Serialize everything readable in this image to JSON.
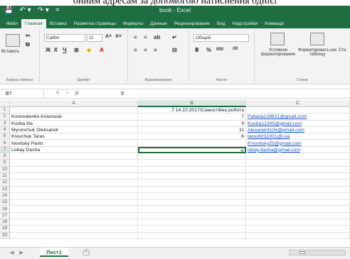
{
  "doc_caption": "ониим адресам за допомогою натиснення однієї",
  "window": {
    "title": "book - Excel"
  },
  "quick_access": [
    "💾",
    "↶ ▾",
    "↷ ▾",
    "="
  ],
  "tabs": [
    "Файл",
    "Главная",
    "Вставка",
    "Разметка страницы",
    "Формулы",
    "Данные",
    "Рецензирование",
    "Вид",
    "Надстройки",
    "Команда"
  ],
  "active_tab": "Главная",
  "ribbon": {
    "clipboard": {
      "label": "Буфер обмена",
      "paste": "Вставить"
    },
    "font": {
      "label": "Шрифт",
      "name": "Calibri",
      "size": "11",
      "grow": "A˄",
      "shrink": "A˅",
      "bold": "Ж",
      "italic": "К",
      "underline": "Ч"
    },
    "alignment": {
      "label": "Выравнивание"
    },
    "number": {
      "label": "Число",
      "format": "Общий",
      "percent": "%",
      "thousands": "000"
    },
    "styles": {
      "label": "Стили",
      "conditional": "Условное форматирование",
      "astable": "Форматировать как таблицу",
      "cellstyles": "Сти"
    }
  },
  "formula_bar": {
    "name_box": "B7",
    "fx": "fx",
    "value": "9"
  },
  "columns": [
    "A",
    "B",
    "C"
  ],
  "selected_column": "B",
  "rows": [
    {
      "n": "1",
      "a": "",
      "b": "7 14.10.2017/Самостійна робота",
      "c": ""
    },
    {
      "n": "2",
      "a": "Konovalenko Anastasia",
      "b": "7",
      "c": "Pallada128821@gmail.com"
    },
    {
      "n": "3",
      "a": "Kovba Illa",
      "b": "9",
      "c": "Kovba12345@gmail.com"
    },
    {
      "n": "4",
      "a": "Myronchuk Oleksandr",
      "b": "11",
      "c": "Alexandr4104@gmail.com"
    },
    {
      "n": "5",
      "a": "Kravchuk Taras",
      "b": "6",
      "c": "taras6032001@i.ua"
    },
    {
      "n": "6",
      "a": "Novitsky Pavlo",
      "b": "",
      "c": "P.novitsky25@gmail.com"
    },
    {
      "n": "7",
      "a": "Lobay Dasha",
      "b": "9",
      "c": "lobay.dasha@gmail.com"
    },
    {
      "n": "8",
      "a": "",
      "b": "",
      "c": ""
    },
    {
      "n": "9",
      "a": "",
      "b": "",
      "c": ""
    },
    {
      "n": "10",
      "a": "",
      "b": "",
      "c": ""
    },
    {
      "n": "11",
      "a": "",
      "b": "",
      "c": ""
    },
    {
      "n": "12",
      "a": "",
      "b": "",
      "c": ""
    },
    {
      "n": "13",
      "a": "",
      "b": "",
      "c": ""
    },
    {
      "n": "14",
      "a": "",
      "b": "",
      "c": ""
    },
    {
      "n": "15",
      "a": "",
      "b": "",
      "c": ""
    },
    {
      "n": "16",
      "a": "",
      "b": "",
      "c": ""
    },
    {
      "n": "17",
      "a": "",
      "b": "",
      "c": ""
    },
    {
      "n": "18",
      "a": "",
      "b": "",
      "c": ""
    },
    {
      "n": "19",
      "a": "",
      "b": "",
      "c": ""
    },
    {
      "n": "20",
      "a": "",
      "b": "",
      "c": ""
    }
  ],
  "active_cell_row": "7",
  "sheet_tabs": [
    "Лист1"
  ],
  "colors": {
    "accent": "#1e6e42",
    "link": "#1a55c8"
  }
}
